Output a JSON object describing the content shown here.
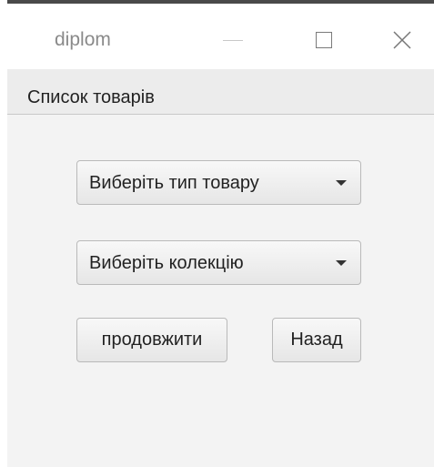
{
  "window": {
    "title": "diplom"
  },
  "menu": {
    "items": [
      "Список товарів"
    ]
  },
  "form": {
    "product_type_combo": "Виберіть тип товару",
    "collection_combo": "Виберіть колекцію",
    "continue_button": "продовжити",
    "back_button": "Назад"
  },
  "icons": {
    "minimize": "minimize-icon",
    "maximize": "maximize-icon",
    "close": "close-icon",
    "dropdown": "chevron-down-icon"
  }
}
